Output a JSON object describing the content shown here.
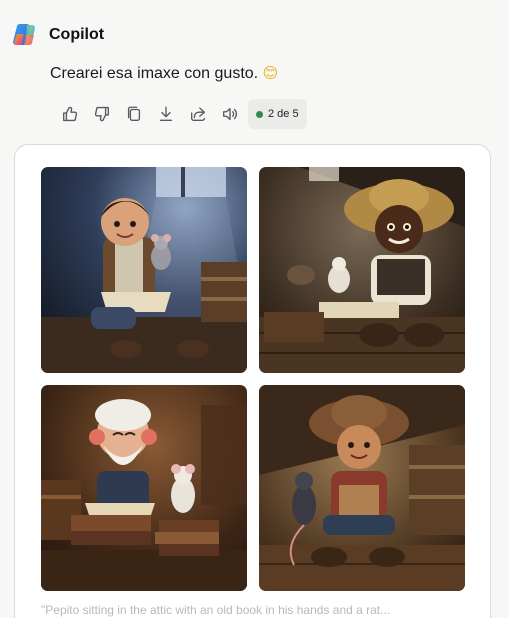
{
  "app": {
    "name": "Copilot",
    "logo_icon": "copilot-logo-icon"
  },
  "message": {
    "text": "Crearei esa imaxe con gusto.",
    "emoji": "😊"
  },
  "actions": {
    "icons": [
      "thumbs-up-icon",
      "thumbs-down-icon",
      "copy-icon",
      "download-icon",
      "share-icon",
      "speaker-icon"
    ],
    "pager_label": "2 de 5",
    "pager_dot_color": "#2e8b4a"
  },
  "gallery": {
    "caption": "\"Pepito sitting in the attic with an old book in his hands and a rat..."
  }
}
